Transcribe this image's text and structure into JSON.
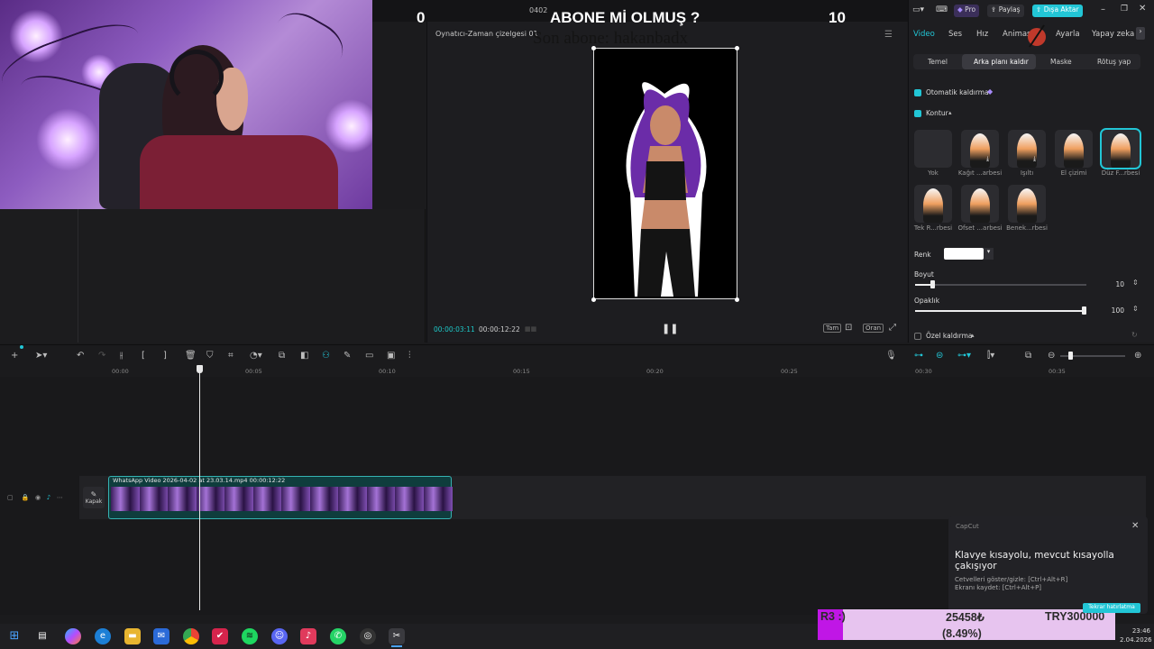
{
  "overlay": {
    "left_counter": "0",
    "small_label": "0402",
    "title": "ABONE Mİ OLMUŞ ?",
    "right_counter": "10",
    "subtitle": "Son abone: hakanbadx"
  },
  "player": {
    "header": "Oynatıcı-Zaman çizelgesi 01",
    "current_time": "00:00:03:11",
    "total_time": "00:00:12:22",
    "buttons": [
      "Tam",
      "Oran"
    ]
  },
  "toolbar_top_right": {
    "pro": "Pro",
    "share": "Paylaş",
    "export": "Dışa Aktar"
  },
  "right_panel": {
    "tabs": [
      "Video",
      "Ses",
      "Hız",
      "Animasyon",
      "Ayarla",
      "Yapay zeka"
    ],
    "active_tab": "Video",
    "subtabs": [
      "Temel",
      "Arka planı kaldır",
      "Maske",
      "Rötuş yap"
    ],
    "active_subtab": "Arka planı kaldır",
    "auto_remove_label": "Otomatik kaldırma",
    "outline_label": "Kontur",
    "outline_styles": [
      {
        "label": "Yok"
      },
      {
        "label": "Kağıt ...arbesi"
      },
      {
        "label": "Işıltı"
      },
      {
        "label": "El çizimi"
      },
      {
        "label": "Düz F...rbesi"
      },
      {
        "label": "Tek R...rbesi"
      },
      {
        "label": "Ofset ...arbesi"
      },
      {
        "label": "Benek...rbesi"
      }
    ],
    "color_label": "Renk",
    "color_value": "#ffffff",
    "size_label": "Boyut",
    "size_value": "10",
    "size_level": 0.1,
    "opacity_label": "Opaklık",
    "opacity_value": "100",
    "opacity_level": 1.0,
    "custom_remove_label": "Özel kaldırma"
  },
  "timeline": {
    "ticks": [
      "00:00",
      "00:05",
      "00:10",
      "00:15",
      "00:20",
      "00:25",
      "00:30",
      "00:35"
    ],
    "clip_label": "WhatsApp Video 2026-04-02 at 23.03.14.mp4   00:00:12:22",
    "cover_label": "Kapak"
  },
  "notification": {
    "app": "CapCut",
    "title": "Klavye kısayolu, mevcut kısayolla çakışıyor",
    "line1": "Cetvelleri göster/gizle: [Ctrl+Alt+R]",
    "line2": "Ekranı kaydet: [Ctrl+Alt+P]",
    "button": "Tekrar hatırlatma"
  },
  "stats": {
    "code": "R3 :)",
    "amount": "25458₺",
    "percent": "(8.49%)",
    "target": "TRY300000"
  },
  "clock": {
    "time": "23:46",
    "date": "2.04.2026"
  },
  "colors": {
    "accent": "#22c6d6",
    "clip_border": "#35b3b3",
    "stats_bg": "#e7c4ef",
    "stats_accent": "#c016e6"
  }
}
